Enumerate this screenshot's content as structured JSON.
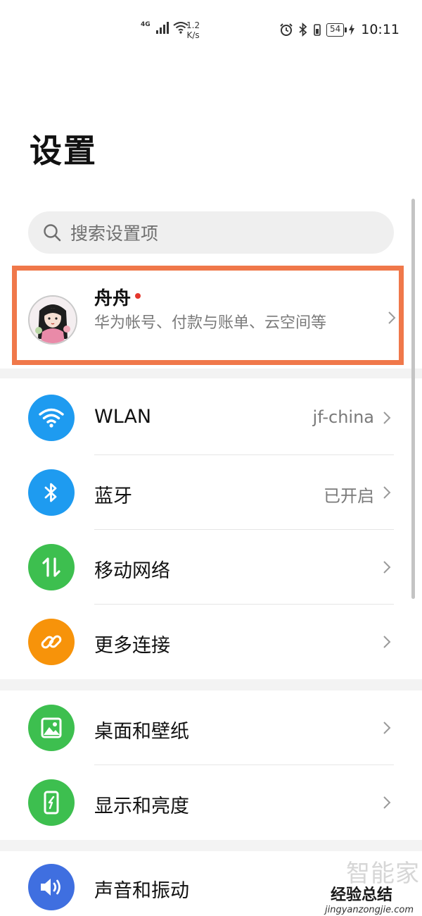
{
  "status_bar": {
    "network": "4G",
    "speed_value": "1.2",
    "speed_unit": "K/s",
    "battery": "54",
    "time": "10:11"
  },
  "page_title": "设置",
  "search": {
    "placeholder": "搜索设置项"
  },
  "account": {
    "name": "舟舟",
    "subtitle": "华为帐号、付款与账单、云空间等"
  },
  "groups": [
    {
      "items": [
        {
          "label": "WLAN",
          "value": "jf-china",
          "icon": "wifi-icon",
          "color": "#1e9bf0"
        },
        {
          "label": "蓝牙",
          "value": "已开启",
          "icon": "bluetooth-icon",
          "color": "#1e9bf0"
        },
        {
          "label": "移动网络",
          "value": "",
          "icon": "mobile-data-icon",
          "color": "#3dbf4f"
        },
        {
          "label": "更多连接",
          "value": "",
          "icon": "link-icon",
          "color": "#f7930a"
        }
      ]
    },
    {
      "items": [
        {
          "label": "桌面和壁纸",
          "value": "",
          "icon": "wallpaper-icon",
          "color": "#3dbf4f"
        },
        {
          "label": "显示和亮度",
          "value": "",
          "icon": "display-icon",
          "color": "#3dbf4f"
        }
      ]
    },
    {
      "items": [
        {
          "label": "声音和振动",
          "value": "",
          "icon": "sound-icon",
          "color": "#3f6fe0"
        }
      ]
    }
  ],
  "watermark": {
    "line1": "智能家",
    "line2": "经验总结",
    "line3": "jingyanzongjie.com"
  }
}
